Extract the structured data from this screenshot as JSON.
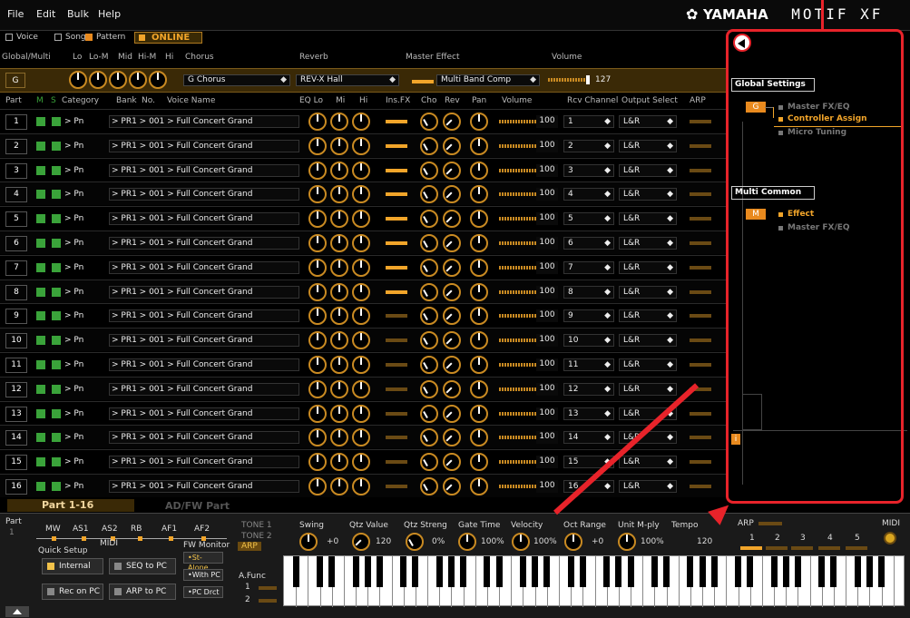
{
  "menu": [
    "File",
    "Edit",
    "Bulk",
    "Help"
  ],
  "brand": {
    "maker": "YAMAHA",
    "model": "MOTIF XF"
  },
  "modes": {
    "voice": "Voice",
    "song": "Song",
    "pattern": "Pattern",
    "online": "ONLINE"
  },
  "global_header": {
    "label": "Global/Multi",
    "lo": "Lo",
    "lo_m": "Lo-M",
    "mid": "Mid",
    "hi_m": "Hi-M",
    "hi": "Hi",
    "chorus": "Chorus",
    "reverb": "Reverb",
    "master_effect": "Master Effect",
    "volume": "Volume"
  },
  "global_row": {
    "button": "G",
    "chorus_value": "G Chorus",
    "reverb_value": "REV-X Hall",
    "master_effect_value": "Multi Band Comp",
    "volume_value": "127"
  },
  "part_header": {
    "part": "Part",
    "m": "M",
    "s": "S",
    "category": "Category",
    "bank": "Bank",
    "no": "No.",
    "voice_name": "Voice Name",
    "eq_lo": "EQ Lo",
    "mi": "Mi",
    "hi": "Hi",
    "ins_fx": "Ins.FX",
    "cho": "Cho",
    "rev": "Rev",
    "pan": "Pan",
    "volume": "Volume",
    "rcv_channel": "Rcv Channel",
    "output_select": "Output Select",
    "arp": "ARP"
  },
  "parts": [
    {
      "num": "1",
      "category": "> Pn",
      "voice": "> PR1 > 001 > Full Concert Grand",
      "volume": "100",
      "rcv": "1",
      "output": "L&R"
    },
    {
      "num": "2",
      "category": "> Pn",
      "voice": "> PR1 > 001 > Full Concert Grand",
      "volume": "100",
      "rcv": "2",
      "output": "L&R"
    },
    {
      "num": "3",
      "category": "> Pn",
      "voice": "> PR1 > 001 > Full Concert Grand",
      "volume": "100",
      "rcv": "3",
      "output": "L&R"
    },
    {
      "num": "4",
      "category": "> Pn",
      "voice": "> PR1 > 001 > Full Concert Grand",
      "volume": "100",
      "rcv": "4",
      "output": "L&R"
    },
    {
      "num": "5",
      "category": "> Pn",
      "voice": "> PR1 > 001 > Full Concert Grand",
      "volume": "100",
      "rcv": "5",
      "output": "L&R"
    },
    {
      "num": "6",
      "category": "> Pn",
      "voice": "> PR1 > 001 > Full Concert Grand",
      "volume": "100",
      "rcv": "6",
      "output": "L&R"
    },
    {
      "num": "7",
      "category": "> Pn",
      "voice": "> PR1 > 001 > Full Concert Grand",
      "volume": "100",
      "rcv": "7",
      "output": "L&R"
    },
    {
      "num": "8",
      "category": "> Pn",
      "voice": "> PR1 > 001 > Full Concert Grand",
      "volume": "100",
      "rcv": "8",
      "output": "L&R"
    },
    {
      "num": "9",
      "category": "> Pn",
      "voice": "> PR1 > 001 > Full Concert Grand",
      "volume": "100",
      "rcv": "9",
      "output": "L&R"
    },
    {
      "num": "10",
      "category": "> Pn",
      "voice": "> PR1 > 001 > Full Concert Grand",
      "volume": "100",
      "rcv": "10",
      "output": "L&R"
    },
    {
      "num": "11",
      "category": "> Pn",
      "voice": "> PR1 > 001 > Full Concert Grand",
      "volume": "100",
      "rcv": "11",
      "output": "L&R"
    },
    {
      "num": "12",
      "category": "> Pn",
      "voice": "> PR1 > 001 > Full Concert Grand",
      "volume": "100",
      "rcv": "12",
      "output": "L&R"
    },
    {
      "num": "13",
      "category": "> Pn",
      "voice": "> PR1 > 001 > Full Concert Grand",
      "volume": "100",
      "rcv": "13",
      "output": "L&R"
    },
    {
      "num": "14",
      "category": "> Pn",
      "voice": "> PR1 > 001 > Full Concert Grand",
      "volume": "100",
      "rcv": "14",
      "output": "L&R"
    },
    {
      "num": "15",
      "category": "> Pn",
      "voice": "> PR1 > 001 > Full Concert Grand",
      "volume": "100",
      "rcv": "15",
      "output": "L&R"
    },
    {
      "num": "16",
      "category": "> Pn",
      "voice": "> PR1 > 001 > Full Concert Grand",
      "volume": "100",
      "rcv": "16",
      "output": "L&R"
    }
  ],
  "tabs": {
    "part": "Part 1-16",
    "adfw": "AD/FW Part"
  },
  "bottom": {
    "part_label": "Part",
    "part_value": "1",
    "slots": [
      "MW",
      "AS1",
      "AS2",
      "RB",
      "AF1",
      "AF2"
    ],
    "quick_setup": "Quick Setup",
    "midi": "MIDI",
    "fw_monitor": "FW Monitor",
    "buttons": {
      "internal": "Internal",
      "seq_to_pc": "SEQ to PC",
      "rec_on_pc": "Rec on PC",
      "arp_to_pc": "ARP to PC"
    },
    "fw": {
      "st_alone": "St-Alone",
      "with_pc": "With PC",
      "pc_drct": "PC Drct"
    },
    "tone1": "TONE 1",
    "tone2": "TONE 2",
    "arp": "ARP",
    "afunc": "A.Func",
    "afunc1": "1",
    "afunc2": "2",
    "params": {
      "swing": "Swing",
      "qtz_value": "Qtz Value",
      "qtz_streng": "Qtz Streng",
      "gate_time": "Gate Time",
      "velocity": "Velocity",
      "oct_range": "Oct Range",
      "unit_mply": "Unit M-ply",
      "tempo": "Tempo"
    },
    "values": {
      "swing": "+0",
      "qtz_value": "120",
      "qtz_streng": "0%",
      "gate_time": "100%",
      "velocity": "100%",
      "oct_range": "+0",
      "unit_mply": "100%",
      "tempo": "120"
    },
    "arp_label": "ARP",
    "arp_slots": [
      "1",
      "2",
      "3",
      "4",
      "5"
    ],
    "midi_label": "MIDI"
  },
  "right_panel": {
    "global_settings": "Global Settings",
    "badge_g": "G",
    "items_global": [
      "Master FX/EQ",
      "Controller Assign",
      "Micro Tuning"
    ],
    "multi_common": "Multi Common",
    "badge_m": "M",
    "items_multi": [
      "Effect",
      "Master FX/EQ"
    ],
    "info": "i"
  },
  "colors": {
    "accent": "#f2a52a",
    "highlight": "#e8232a",
    "mute_solo": "#3aa33a"
  }
}
